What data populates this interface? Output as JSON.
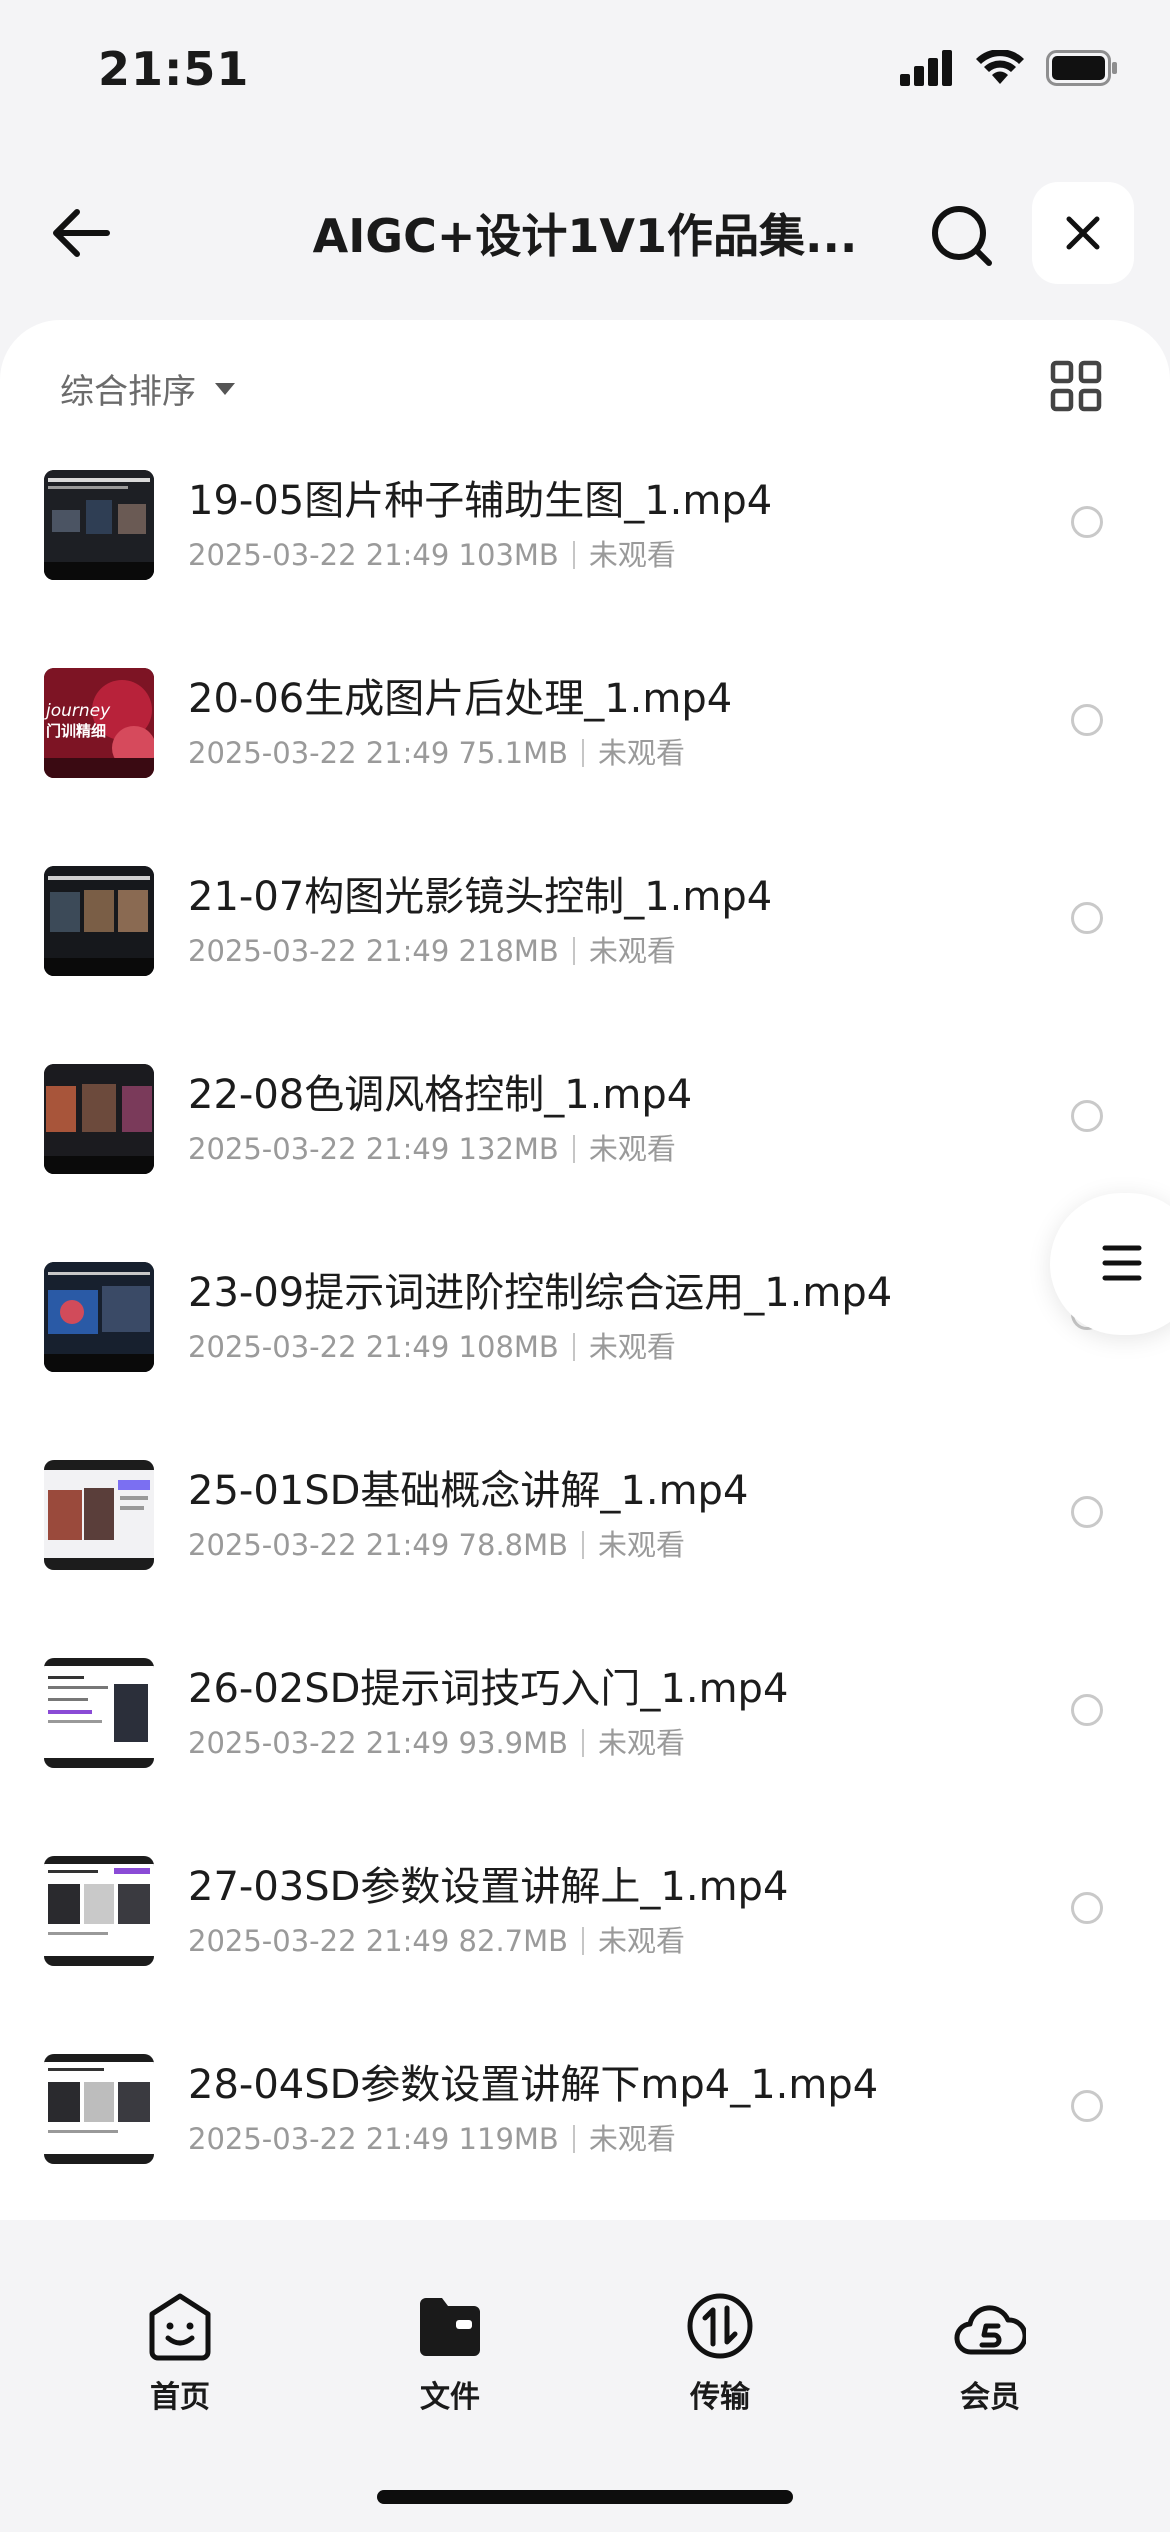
{
  "status_bar": {
    "time": "21:51",
    "icons": [
      "signal-icon",
      "wifi-icon",
      "battery-icon"
    ]
  },
  "nav": {
    "title": "AIGC+设计1V1作品集...",
    "icons": [
      "back-arrow-icon",
      "search-icon",
      "close-icon"
    ]
  },
  "sort": {
    "label": "综合排序",
    "icon": "caret-down-icon",
    "view_icon": "grid-view-icon"
  },
  "files": [
    {
      "name": "19-05图片种子辅助生图_1.mp4",
      "date": "2025-03-22 21:49",
      "size": "103MB",
      "status": "未观看",
      "thumb": "dark"
    },
    {
      "name": "20-06生成图片后处理_1.mp4",
      "date": "2025-03-22 21:49",
      "size": "75.1MB",
      "status": "未观看",
      "thumb": "red",
      "thumb_text": [
        "journey",
        "门训精细"
      ]
    },
    {
      "name": "21-07构图光影镜头控制_1.mp4",
      "date": "2025-03-22 21:49",
      "size": "218MB",
      "status": "未观看",
      "thumb": "dark"
    },
    {
      "name": "22-08色调风格控制_1.mp4",
      "date": "2025-03-22 21:49",
      "size": "132MB",
      "status": "未观看",
      "thumb": "warm"
    },
    {
      "name": "23-09提示词进阶控制综合运用_1.mp4",
      "date": "2025-03-22 21:49",
      "size": "108MB",
      "status": "未观看",
      "thumb": "blue"
    },
    {
      "name": "25-01SD基础概念讲解_1.mp4",
      "date": "2025-03-22 21:49",
      "size": "78.8MB",
      "status": "未观看",
      "thumb": "light"
    },
    {
      "name": "26-02SD提示词技巧入门_1.mp4",
      "date": "2025-03-22 21:49",
      "size": "93.9MB",
      "status": "未观看",
      "thumb": "white"
    },
    {
      "name": "27-03SD参数设置讲解上_1.mp4",
      "date": "2025-03-22 21:49",
      "size": "82.7MB",
      "status": "未观看",
      "thumb": "cats"
    },
    {
      "name": "28-04SD参数设置讲解下mp4_1.mp4",
      "date": "2025-03-22 21:49",
      "size": "119MB",
      "status": "未观看",
      "thumb": "cats"
    }
  ],
  "float_menu": {
    "icon": "menu-lines-icon"
  },
  "tabs": [
    {
      "label": "首页",
      "icon": "home-smile-icon"
    },
    {
      "label": "文件",
      "icon": "folder-icon"
    },
    {
      "label": "传输",
      "icon": "transfer-icon"
    },
    {
      "label": "会员",
      "icon": "vip-cloud-icon"
    }
  ]
}
